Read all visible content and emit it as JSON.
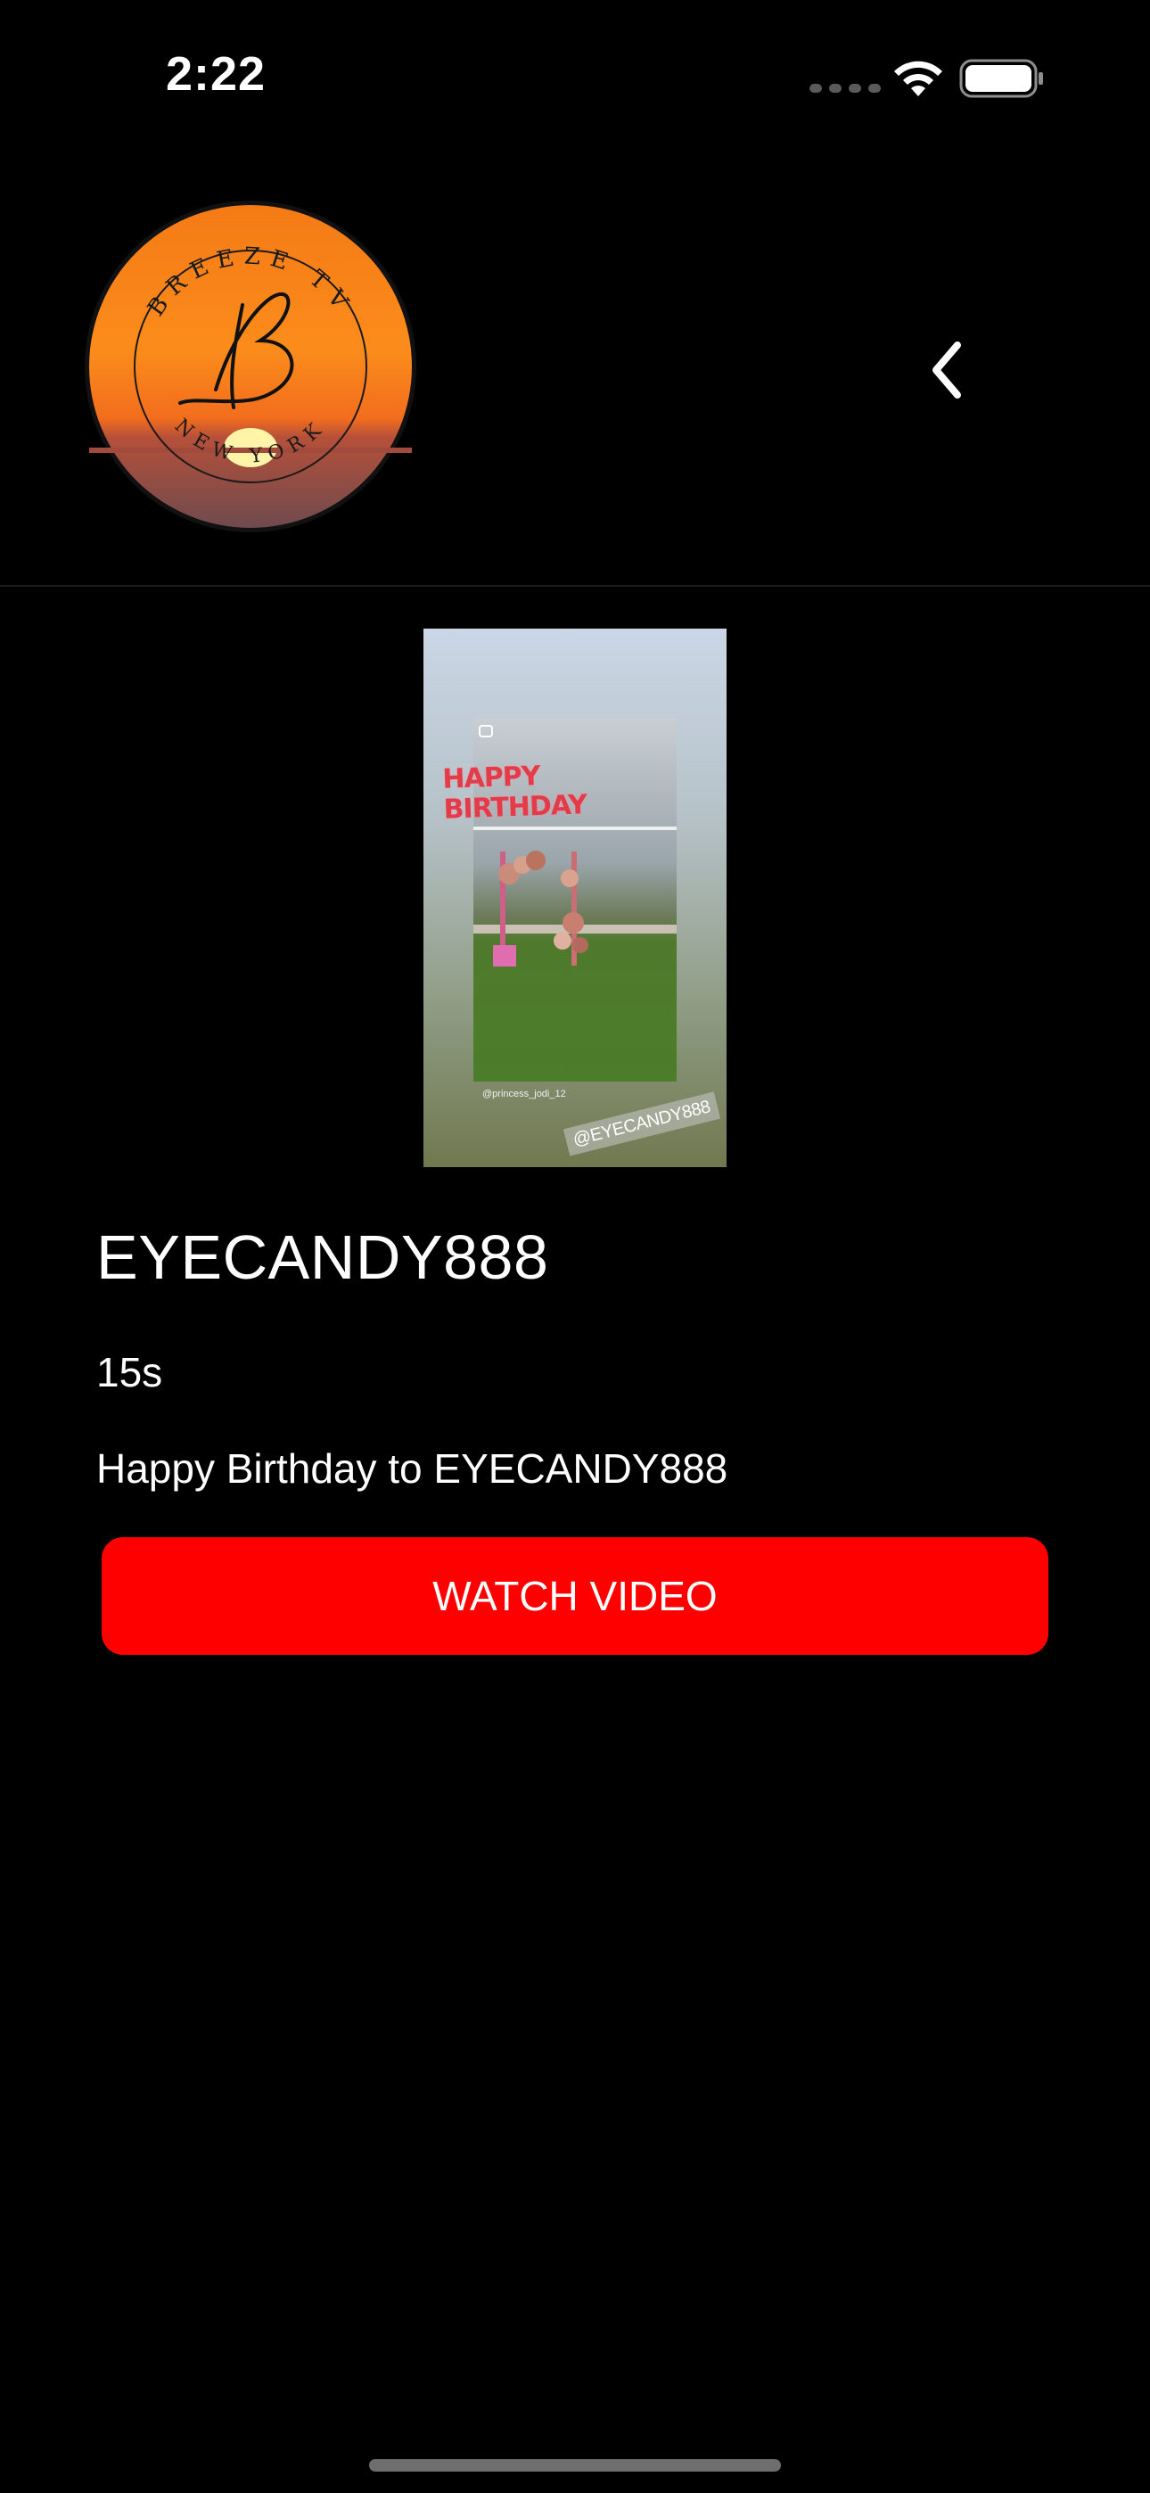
{
  "status_bar": {
    "time": "2:22",
    "icons": [
      "signal-icon",
      "wifi-icon",
      "battery-icon"
    ]
  },
  "header": {
    "logo": {
      "top_text": "BREEZE TV",
      "bottom_text": "NEW YORK",
      "monogram": "B"
    },
    "back_icon": "chevron-left-icon"
  },
  "thumbnail": {
    "overlay_text": "HAPPY BIRTHDAY",
    "credit": "@princess_jodi_12",
    "tag": "@EYECANDY888"
  },
  "content": {
    "title": "EYECANDY888",
    "duration": "15s",
    "description": "Happy Birthday to EYECANDY888",
    "watch_button_label": "WATCH VIDEO"
  },
  "colors": {
    "background": "#000000",
    "accent": "#ff0000",
    "text": "#ffffff"
  }
}
